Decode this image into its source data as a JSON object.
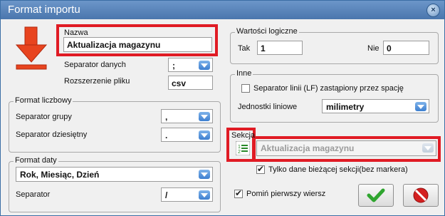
{
  "window": {
    "title": "Format importu",
    "close_icon": "close-icon"
  },
  "nazwa": {
    "label": "Nazwa",
    "value": "Aktualizacja magazynu"
  },
  "separator_danych": {
    "label": "Separator danych",
    "value": ";"
  },
  "rozszerzenie": {
    "label": "Rozszerzenie pliku",
    "value": "csv"
  },
  "format_liczbowy": {
    "title": "Format liczbowy",
    "grupy_label": "Separator grupy",
    "grupy_value": ",",
    "dziesietny_label": "Separator dziesiętny",
    "dziesietny_value": "."
  },
  "format_daty": {
    "title": "Format daty",
    "format_value": "Rok, Miesiąc, Dzień",
    "separator_label": "Separator",
    "separator_value": "/"
  },
  "wartosci_logiczne": {
    "title": "Wartości logiczne",
    "tak_label": "Tak",
    "tak_value": "1",
    "nie_label": "Nie",
    "nie_value": "0"
  },
  "inne": {
    "title": "Inne",
    "lf_label": "Separator linii (LF) zastąpiony przez spację",
    "lf_checked": false,
    "jednostki_label": "Jednostki liniowe",
    "jednostki_value": "milimetry"
  },
  "sekcja": {
    "label": "Sekcja",
    "value": "Aktualizacja magazynu",
    "tylko_label": "Tylko dane bieżącej sekcji(bez markera)",
    "tylko_checked": true
  },
  "pomin": {
    "label": "Pomiń pierwszy wiersz",
    "checked": true
  },
  "colors": {
    "title_bar": "#4a76ad",
    "highlight": "#e01b24",
    "ok": "#2fa52f",
    "cancel": "#d42020"
  }
}
